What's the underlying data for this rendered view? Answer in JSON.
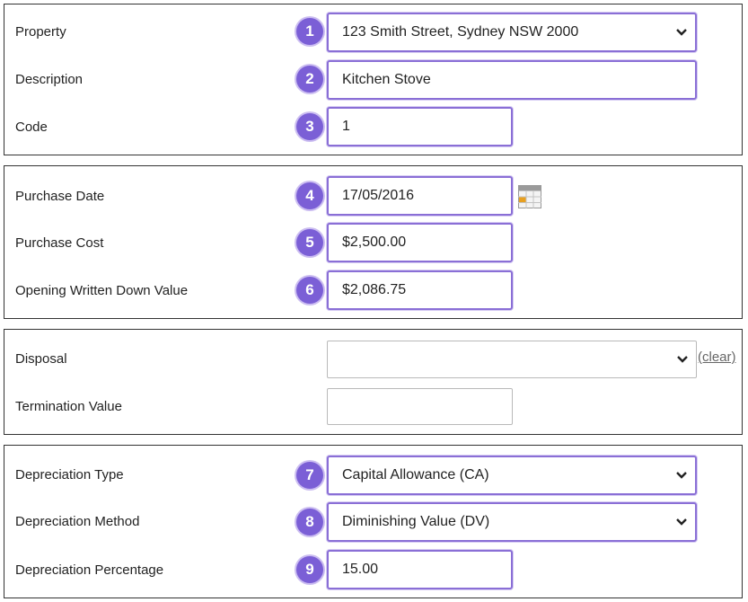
{
  "section_property": {
    "property": {
      "label": "Property",
      "value": "123 Smith Street, Sydney NSW 2000",
      "badge": "1"
    },
    "description": {
      "label": "Description",
      "value": "Kitchen Stove",
      "badge": "2"
    },
    "code": {
      "label": "Code",
      "value": "1",
      "badge": "3"
    }
  },
  "section_purchase": {
    "purchase_date": {
      "label": "Purchase Date",
      "value": "17/05/2016",
      "badge": "4"
    },
    "purchase_cost": {
      "label": "Purchase Cost",
      "value": "$2,500.00",
      "badge": "5"
    },
    "opening_wdv": {
      "label": "Opening Written Down Value",
      "value": "$2,086.75",
      "badge": "6"
    }
  },
  "section_disposal": {
    "disposal": {
      "label": "Disposal",
      "value": "",
      "clear_label": "(clear)"
    },
    "termination_value": {
      "label": "Termination Value",
      "value": ""
    }
  },
  "section_depreciation": {
    "type": {
      "label": "Depreciation Type",
      "value": "Capital Allowance (CA)",
      "badge": "7"
    },
    "method": {
      "label": "Depreciation Method",
      "value": "Diminishing Value (DV)",
      "badge": "8"
    },
    "percentage": {
      "label": "Depreciation Percentage",
      "value": "15.00",
      "badge": "9"
    }
  },
  "colors": {
    "badge": "#7b5fd6",
    "highlight_border": "#8a6fd6",
    "section_border": "#333333"
  },
  "icons": {
    "dropdown": "chevron-down-icon",
    "date_picker": "calendar-icon"
  }
}
